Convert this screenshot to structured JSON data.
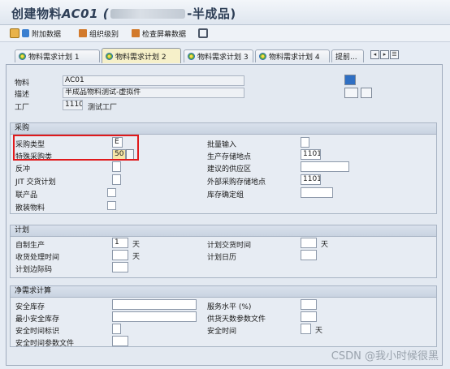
{
  "window": {
    "title_prefix": "创建物料",
    "title_material": "AC01",
    "title_suffix": "-半成品"
  },
  "toolbar": {
    "additional_data": "附加数据",
    "org_levels": "组织级别",
    "check_screen_data": "检查屏幕数据"
  },
  "tabs": [
    {
      "label": "物料需求计划 1"
    },
    {
      "label": "物料需求计划 2"
    },
    {
      "label": "物料需求计划 3"
    },
    {
      "label": "物料需求计划 4"
    },
    {
      "label": "提前..."
    }
  ],
  "header": {
    "material_label": "物料",
    "material_value": "AC01",
    "description_label": "描述",
    "description_value": "半成品物料测试-虚拟件",
    "plant_label": "工厂",
    "plant_value": "1110",
    "plant_name": "测试工厂"
  },
  "procurement": {
    "title": "采购",
    "proc_type_label": "采购类型",
    "proc_type_value": "E",
    "special_proc_label": "特殊采购类",
    "special_proc_value": "50",
    "backflush_label": "反冲",
    "jit_label": "JIT 交货计划",
    "coproduct_label": "联产品",
    "bulk_label": "散装物料",
    "batch_entry_label": "批量输入",
    "prod_stor_loc_label": "生产存储地点",
    "prod_stor_loc_value": "1101",
    "default_supply_area_label": "建议的供应区",
    "ext_proc_stor_loc_label": "外部采购存储地点",
    "ext_proc_stor_loc_value": "1101",
    "storage_bin_label": "库存确定组"
  },
  "scheduling": {
    "title": "计划",
    "inhouse_prod_label": "自制生产",
    "inhouse_prod_value": "1",
    "inhouse_unit": "天",
    "gr_proc_time_label": "收货处理时间",
    "gr_unit": "天",
    "sched_margin_label": "计划边际码",
    "planned_deliv_label": "计划交货时间",
    "planned_deliv_unit": "天",
    "planning_calendar_label": "计划日历"
  },
  "net_requirements": {
    "title": "净需求计算",
    "safety_stock_label": "安全库存",
    "min_safety_stock_label": "最小安全库存",
    "safety_time_ind_label": "安全时间标识",
    "safety_time_profile_label": "安全时间参数文件",
    "service_level_label": "服务水平 (%)",
    "coverage_profile_label": "供货天数参数文件",
    "safety_time_label": "安全时间",
    "safety_time_unit": "天"
  },
  "watermark": "CSDN @我小时候很黑"
}
